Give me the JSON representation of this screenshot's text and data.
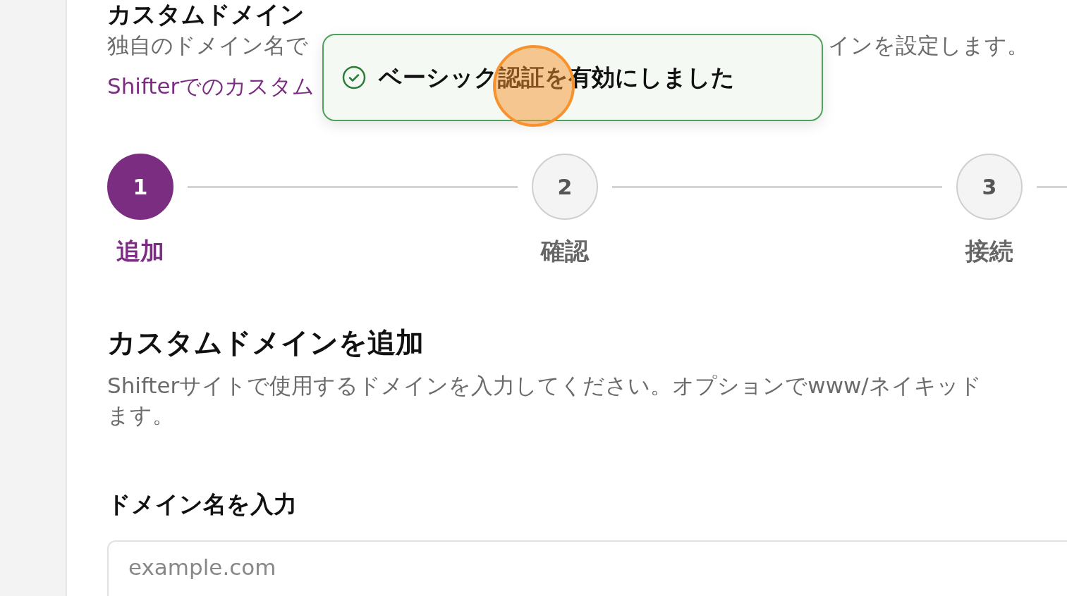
{
  "page_title": "カスタムドメイン",
  "intro": {
    "before": "独自のドメイン名で",
    "after": "インを設定します。"
  },
  "docs_link": "Shifterでのカスタム",
  "toast": {
    "kind": "success",
    "message": "ベーシック認証を有効にしました"
  },
  "steps": [
    {
      "number": "1",
      "label": "追加",
      "selected": true
    },
    {
      "number": "2",
      "label": "確認",
      "selected": false
    },
    {
      "number": "3",
      "label": "接続",
      "selected": false
    }
  ],
  "section": {
    "title": "カスタムドメインを追加",
    "description_lines": [
      "Shifterサイトで使用するドメインを入力してください。オプションでwww/ネイキッド",
      "ます。"
    ]
  },
  "domain_field": {
    "label": "ドメイン名を入力",
    "placeholder": "example.com"
  }
}
